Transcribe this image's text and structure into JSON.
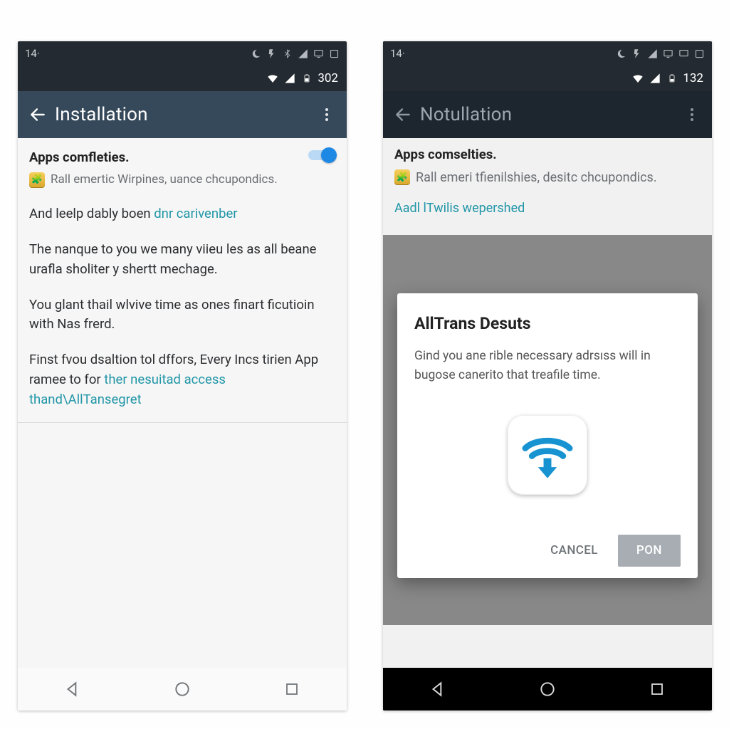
{
  "left": {
    "status1": {
      "time": "14·",
      "icons": [
        "moon-icon",
        "flash-icon",
        "bluetooth-icon",
        "signal-icon",
        "screen-icon",
        "card-icon"
      ]
    },
    "status2": {
      "battery_text": "302"
    },
    "appbar": {
      "title": "Installation"
    },
    "section": {
      "heading": "Apps comfleties.",
      "subtitle": "Rall emertic Wirpines, uance chcupondics."
    },
    "p1_a": "And leelp dably boen ",
    "p1_link": "dnr carivenber",
    "p2": "The nanque to you we many viieu les as all beane urafla sholiter y shertt mechage.",
    "p3": "You glant thail wlvive time as ones finart ficutioin with Nas frerd.",
    "p4_a": "Finst fvou dsaltion tol dffors, Every Incs tirien App ramee to for ",
    "p4_link": "ther nesuitad access thand\\AllTansegret"
  },
  "right": {
    "status1": {
      "time": "14·",
      "icons": [
        "moon-icon",
        "flash-icon",
        "signal-icon",
        "screen-icon",
        "screen2-icon",
        "card-icon"
      ]
    },
    "status2": {
      "battery_text": "132"
    },
    "appbar": {
      "title": "Notullation"
    },
    "bg": {
      "heading": "Apps comselties.",
      "subtitle": "Rall emeri tfienilshies, desitc chcupondics.",
      "linkish": "Aadl lTwilis wepershed"
    },
    "dialog": {
      "title": "AllTrans Desuts",
      "body": "Gind you ane rible necessary adrsıss will in bugose canerito that treafile time.",
      "cancel": "CANCEL",
      "confirm": "PON"
    }
  }
}
